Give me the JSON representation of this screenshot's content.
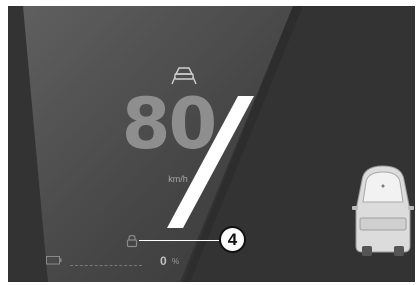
{
  "cluster": {
    "speed": "80",
    "speed_unit": "km/h",
    "callout_number": "4",
    "level_value": "0",
    "level_unit": "%"
  },
  "icons": {
    "adas": "lane-following-car-icon",
    "lock": "lock-icon",
    "battery": "battery-icon",
    "vehicle": "vehicle-rear-icon"
  },
  "colors": {
    "background": "#333333",
    "highlight_stripe": "#ffffff",
    "speed_text": "#8e8e8e",
    "callout_fill": "#ffffff"
  }
}
